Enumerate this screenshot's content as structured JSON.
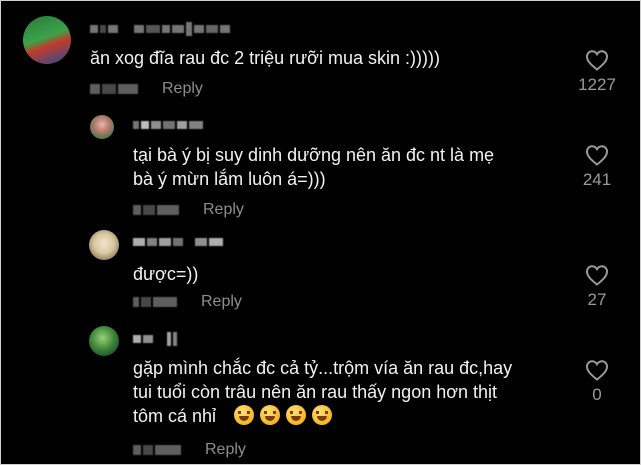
{
  "comments": [
    {
      "text_lines": [
        "ăn xog đĩa rau đc 2 triệu rưỡi mua skin :)))))"
      ],
      "reply_label": "Reply",
      "likes": "1227",
      "is_reply": false
    },
    {
      "text_lines": [
        "tại bà ý bị suy dinh dưỡng nên ăn đc nt là mẹ",
        "bà ý mừn lắm luôn á=)))"
      ],
      "reply_label": "Reply",
      "likes": "241",
      "is_reply": true
    },
    {
      "text_lines": [
        "được=))"
      ],
      "reply_label": "Reply",
      "likes": "27",
      "is_reply": true
    },
    {
      "text_lines": [
        "gặp mình chắc đc cả tỷ...trộm vía ăn rau đc,hay",
        "tui tuổi còn trâu nên ăn rau thấy ngon hơn thịt",
        "tôm cá nhỉ"
      ],
      "emoji_icons": [
        "rofl-emoji-icon",
        "rofl-emoji-icon",
        "rofl-emoji-icon",
        "rofl-emoji-icon"
      ],
      "reply_label": "Reply",
      "likes": "0",
      "is_reply": true
    }
  ],
  "icons": {
    "like": "heart-outline-icon"
  },
  "colors": {
    "background": "#000000",
    "text": "#f2f2f2",
    "muted": "#8b8b8b"
  }
}
